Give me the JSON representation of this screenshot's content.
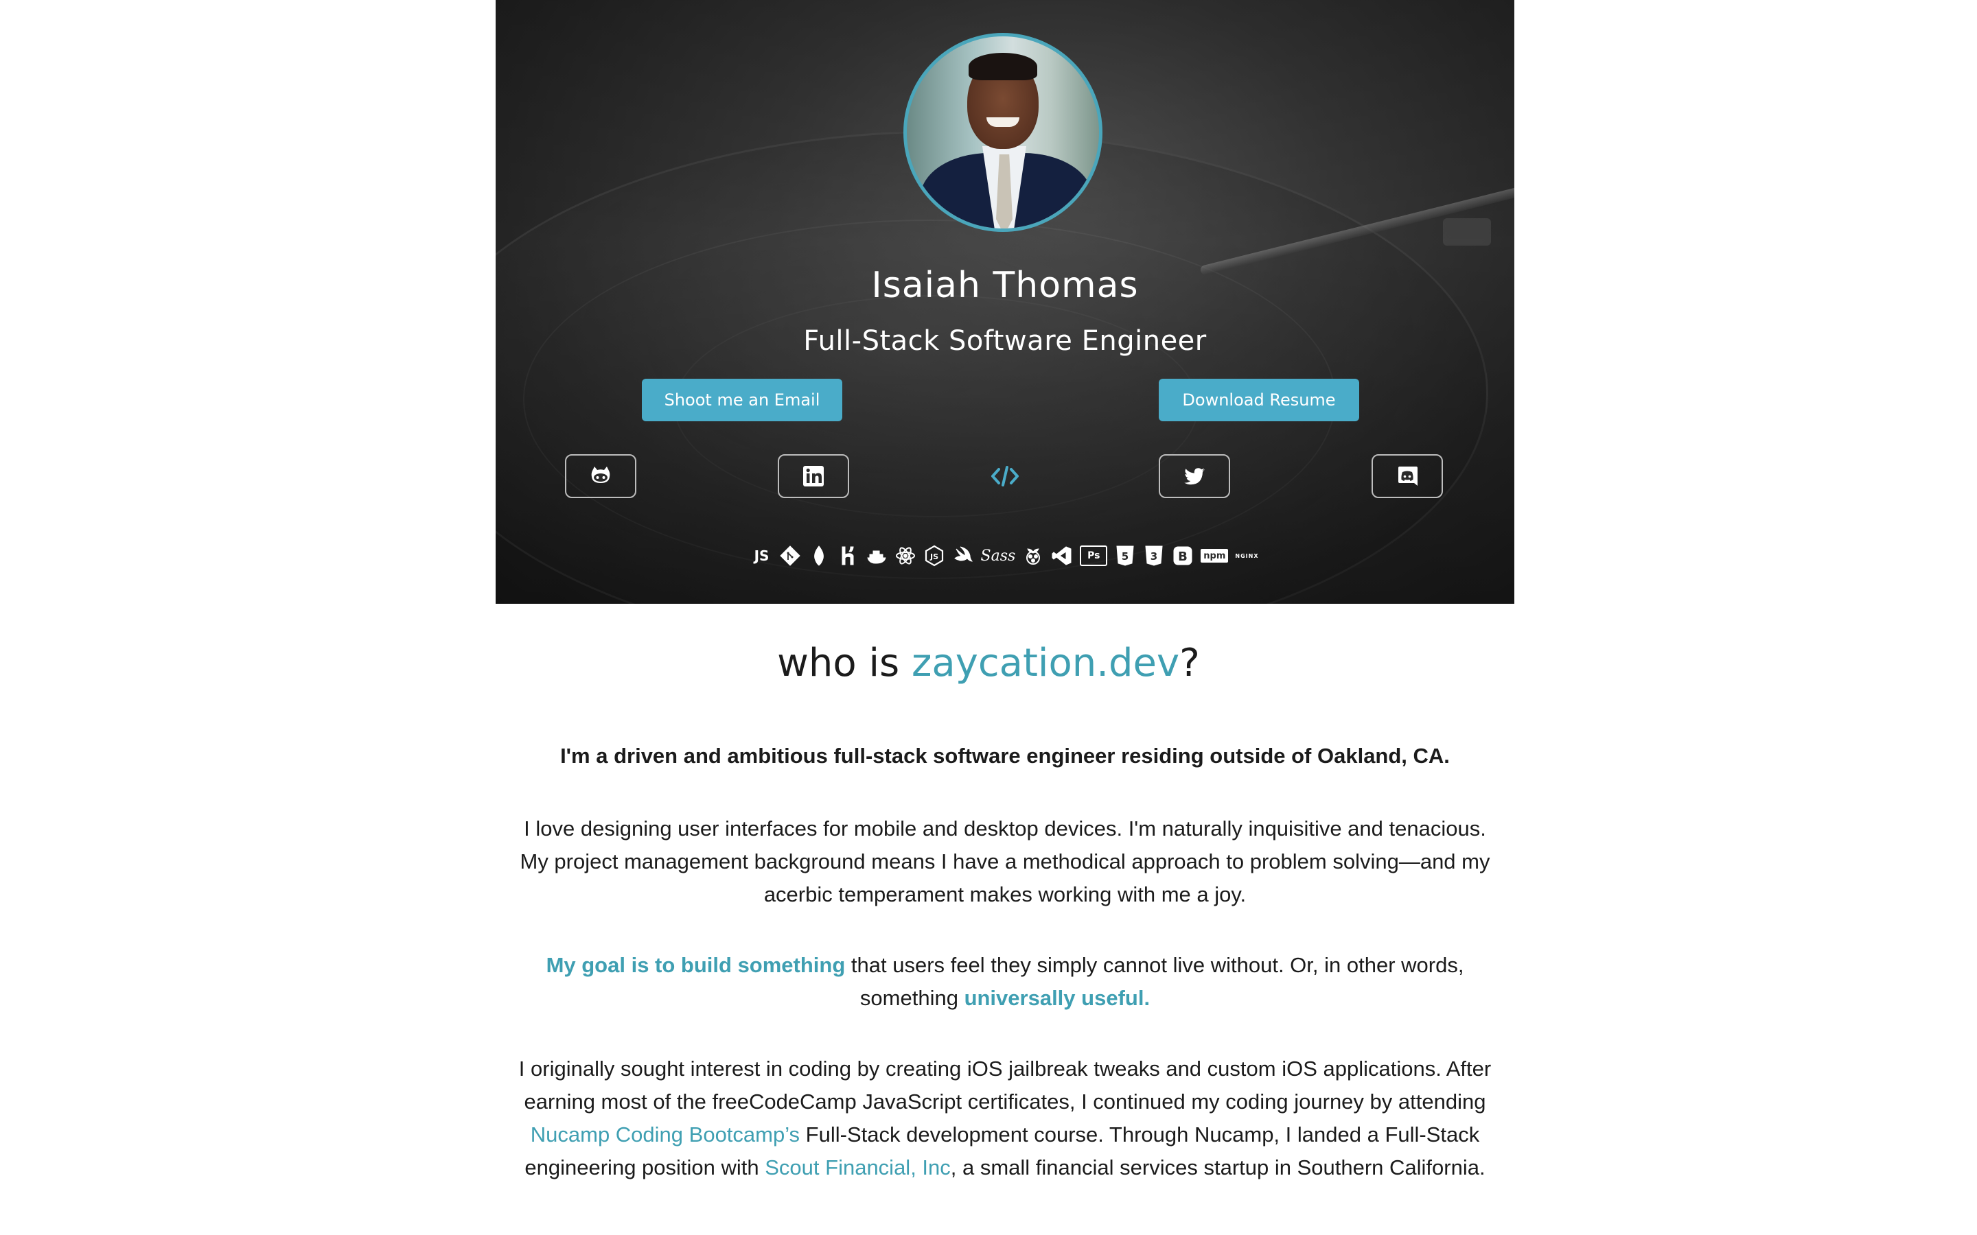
{
  "hero": {
    "name": "Isaiah Thomas",
    "title": "Full-Stack Software Engineer",
    "buttons": {
      "email": "Shoot me an Email",
      "resume": "Download Resume"
    },
    "social": [
      "github-icon",
      "linkedin-icon",
      "code-icon",
      "twitter-icon",
      "discord-icon"
    ],
    "tech_stack": [
      {
        "icon": "javascript-icon",
        "label": "JS"
      },
      {
        "icon": "git-icon"
      },
      {
        "icon": "mongodb-icon"
      },
      {
        "icon": "heroku-icon"
      },
      {
        "icon": "docker-icon"
      },
      {
        "icon": "react-icon"
      },
      {
        "icon": "nodejs-icon"
      },
      {
        "icon": "swift-icon"
      },
      {
        "icon": "sass-icon",
        "label": "Sass"
      },
      {
        "icon": "raspberry-pi-icon"
      },
      {
        "icon": "vscode-icon"
      },
      {
        "icon": "photoshop-icon",
        "label": "Ps"
      },
      {
        "icon": "html5-icon",
        "label": "5"
      },
      {
        "icon": "css3-icon",
        "label": "3"
      },
      {
        "icon": "bootstrap-icon",
        "label": "B"
      },
      {
        "icon": "npm-icon",
        "label": "npm"
      },
      {
        "icon": "nginx-icon",
        "label": "NGINX"
      }
    ],
    "accent_color": "#4aacc9"
  },
  "about": {
    "title_prefix": "who is ",
    "title_accent": "zaycation.dev",
    "title_suffix": "?",
    "intro": "I'm a driven and ambitious full-stack software engineer residing outside of Oakland, CA.",
    "love": "I love designing user interfaces for mobile and desktop devices. I'm naturally inquisitive and tenacious. My project management background means I have a methodical approach to problem solving—and my acerbic temperament makes working with me a joy.",
    "goal": {
      "accent1": "My goal is to build something",
      "middle": " that users feel they simply cannot live without. Or, in other words, something ",
      "accent2": "universally useful."
    },
    "origin": {
      "part1": "I originally sought interest in coding by creating iOS jailbreak tweaks and custom iOS applications. After earning most of the freeCodeCamp JavaScript certificates, I continued my coding journey by attending ",
      "link1": "Nucamp Coding Bootcamp’s",
      "part2": " Full-Stack development course. Through Nucamp, I landed a Full-Stack engineering position with ",
      "link2": "Scout Financial, Inc",
      "part3": ", a small financial services startup in Southern California."
    },
    "accent_color": "#3f9fb2"
  }
}
